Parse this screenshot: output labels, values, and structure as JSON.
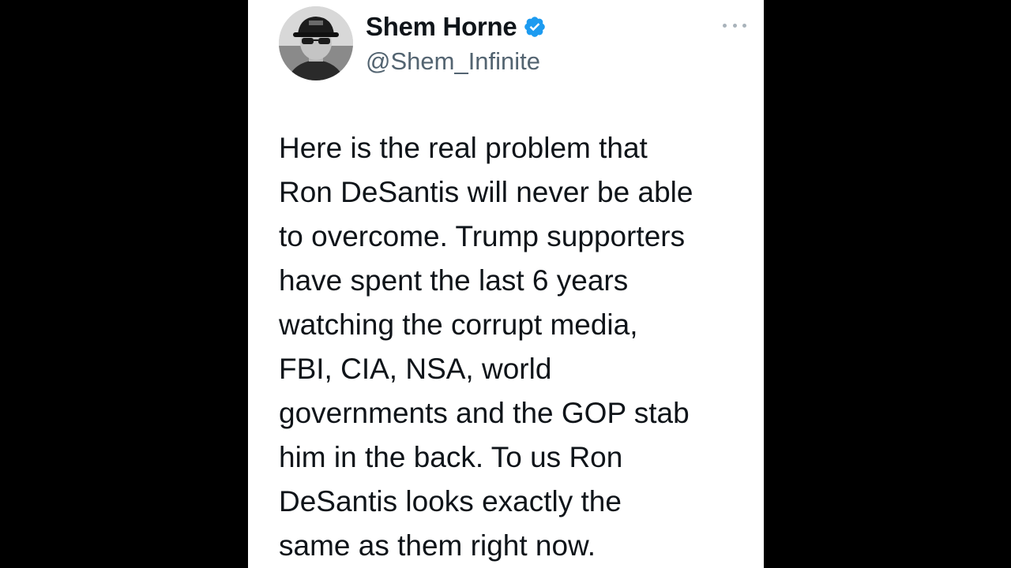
{
  "tweet": {
    "author": {
      "display_name": "Shem Horne",
      "handle": "@Shem_Infinite",
      "verified": true,
      "verified_icon": "verified-badge-icon",
      "avatar_icon": "user-avatar"
    },
    "more_icon": "more-options-icon",
    "text_lines": [
      "Here is the real problem that",
      "Ron DeSantis will never be able",
      "to overcome. Trump supporters",
      "have spent the last 6 years",
      "watching the corrupt media,",
      "FBI, CIA, NSA, world",
      "governments and the GOP stab",
      "him in the back. To us Ron",
      "DeSantis looks exactly the",
      "same as them right now."
    ]
  },
  "colors": {
    "background": "#000000",
    "card": "#ffffff",
    "text": "#0f1419",
    "handle": "#536471",
    "verified": "#1d9bf0"
  }
}
